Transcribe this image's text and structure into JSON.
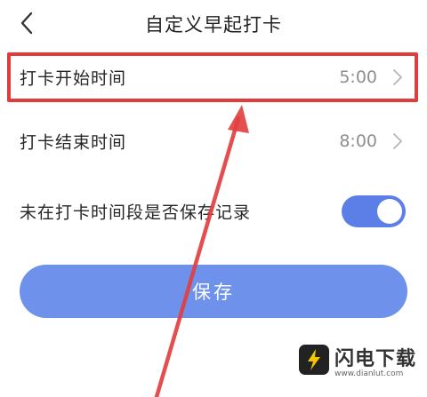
{
  "header": {
    "title": "自定义早起打卡",
    "back_icon": "chevron-left-icon"
  },
  "settings": {
    "start_time": {
      "label": "打卡开始时间",
      "value": "5:00"
    },
    "end_time": {
      "label": "打卡结束时间",
      "value": "8:00"
    },
    "save_record": {
      "label": "未在打卡时间段是否保存记录",
      "enabled": true
    }
  },
  "actions": {
    "save_label": "保存"
  },
  "watermark": {
    "brand": "闪电下载",
    "url": "www.dianlut.com"
  },
  "colors": {
    "accent": "#6e92ec",
    "toggle_on": "#5b7fe6",
    "annotation_red": "#e23b3b",
    "value_gray": "#8e8e8e"
  }
}
